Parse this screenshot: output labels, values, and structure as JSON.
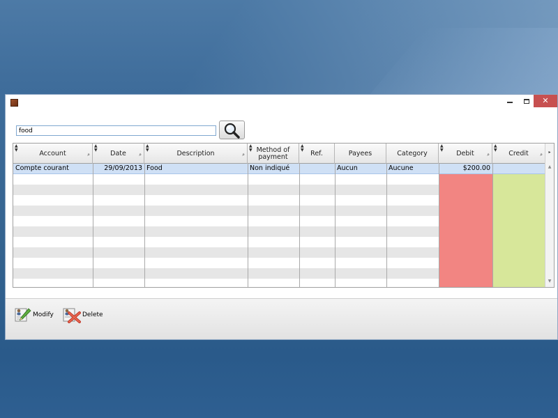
{
  "search": {
    "value": "food",
    "placeholder": ""
  },
  "grid": {
    "columns": [
      {
        "key": "account",
        "label": "Account"
      },
      {
        "key": "date",
        "label": "Date"
      },
      {
        "key": "description",
        "label": "Description"
      },
      {
        "key": "method",
        "label": "Method of payment"
      },
      {
        "key": "ref",
        "label": "Ref."
      },
      {
        "key": "payees",
        "label": "Payees"
      },
      {
        "key": "category",
        "label": "Category"
      },
      {
        "key": "debit",
        "label": "Debit"
      },
      {
        "key": "credit",
        "label": "Credit"
      }
    ],
    "rows": [
      {
        "account": "Compte courant",
        "date": "29/09/2013",
        "description": "Food",
        "method": "Non indiqué",
        "ref": "",
        "payees": "Aucun",
        "category": "Aucune",
        "debit": "$200.00",
        "credit": ""
      }
    ]
  },
  "toolbar": {
    "modify_label": "Modify",
    "delete_label": "Delete"
  },
  "colors": {
    "debit": "#f28582",
    "credit": "#d7e79a",
    "selected_row": "#cfe0f5",
    "stripe": "#e6e6e6",
    "close_button": "#c75050"
  }
}
